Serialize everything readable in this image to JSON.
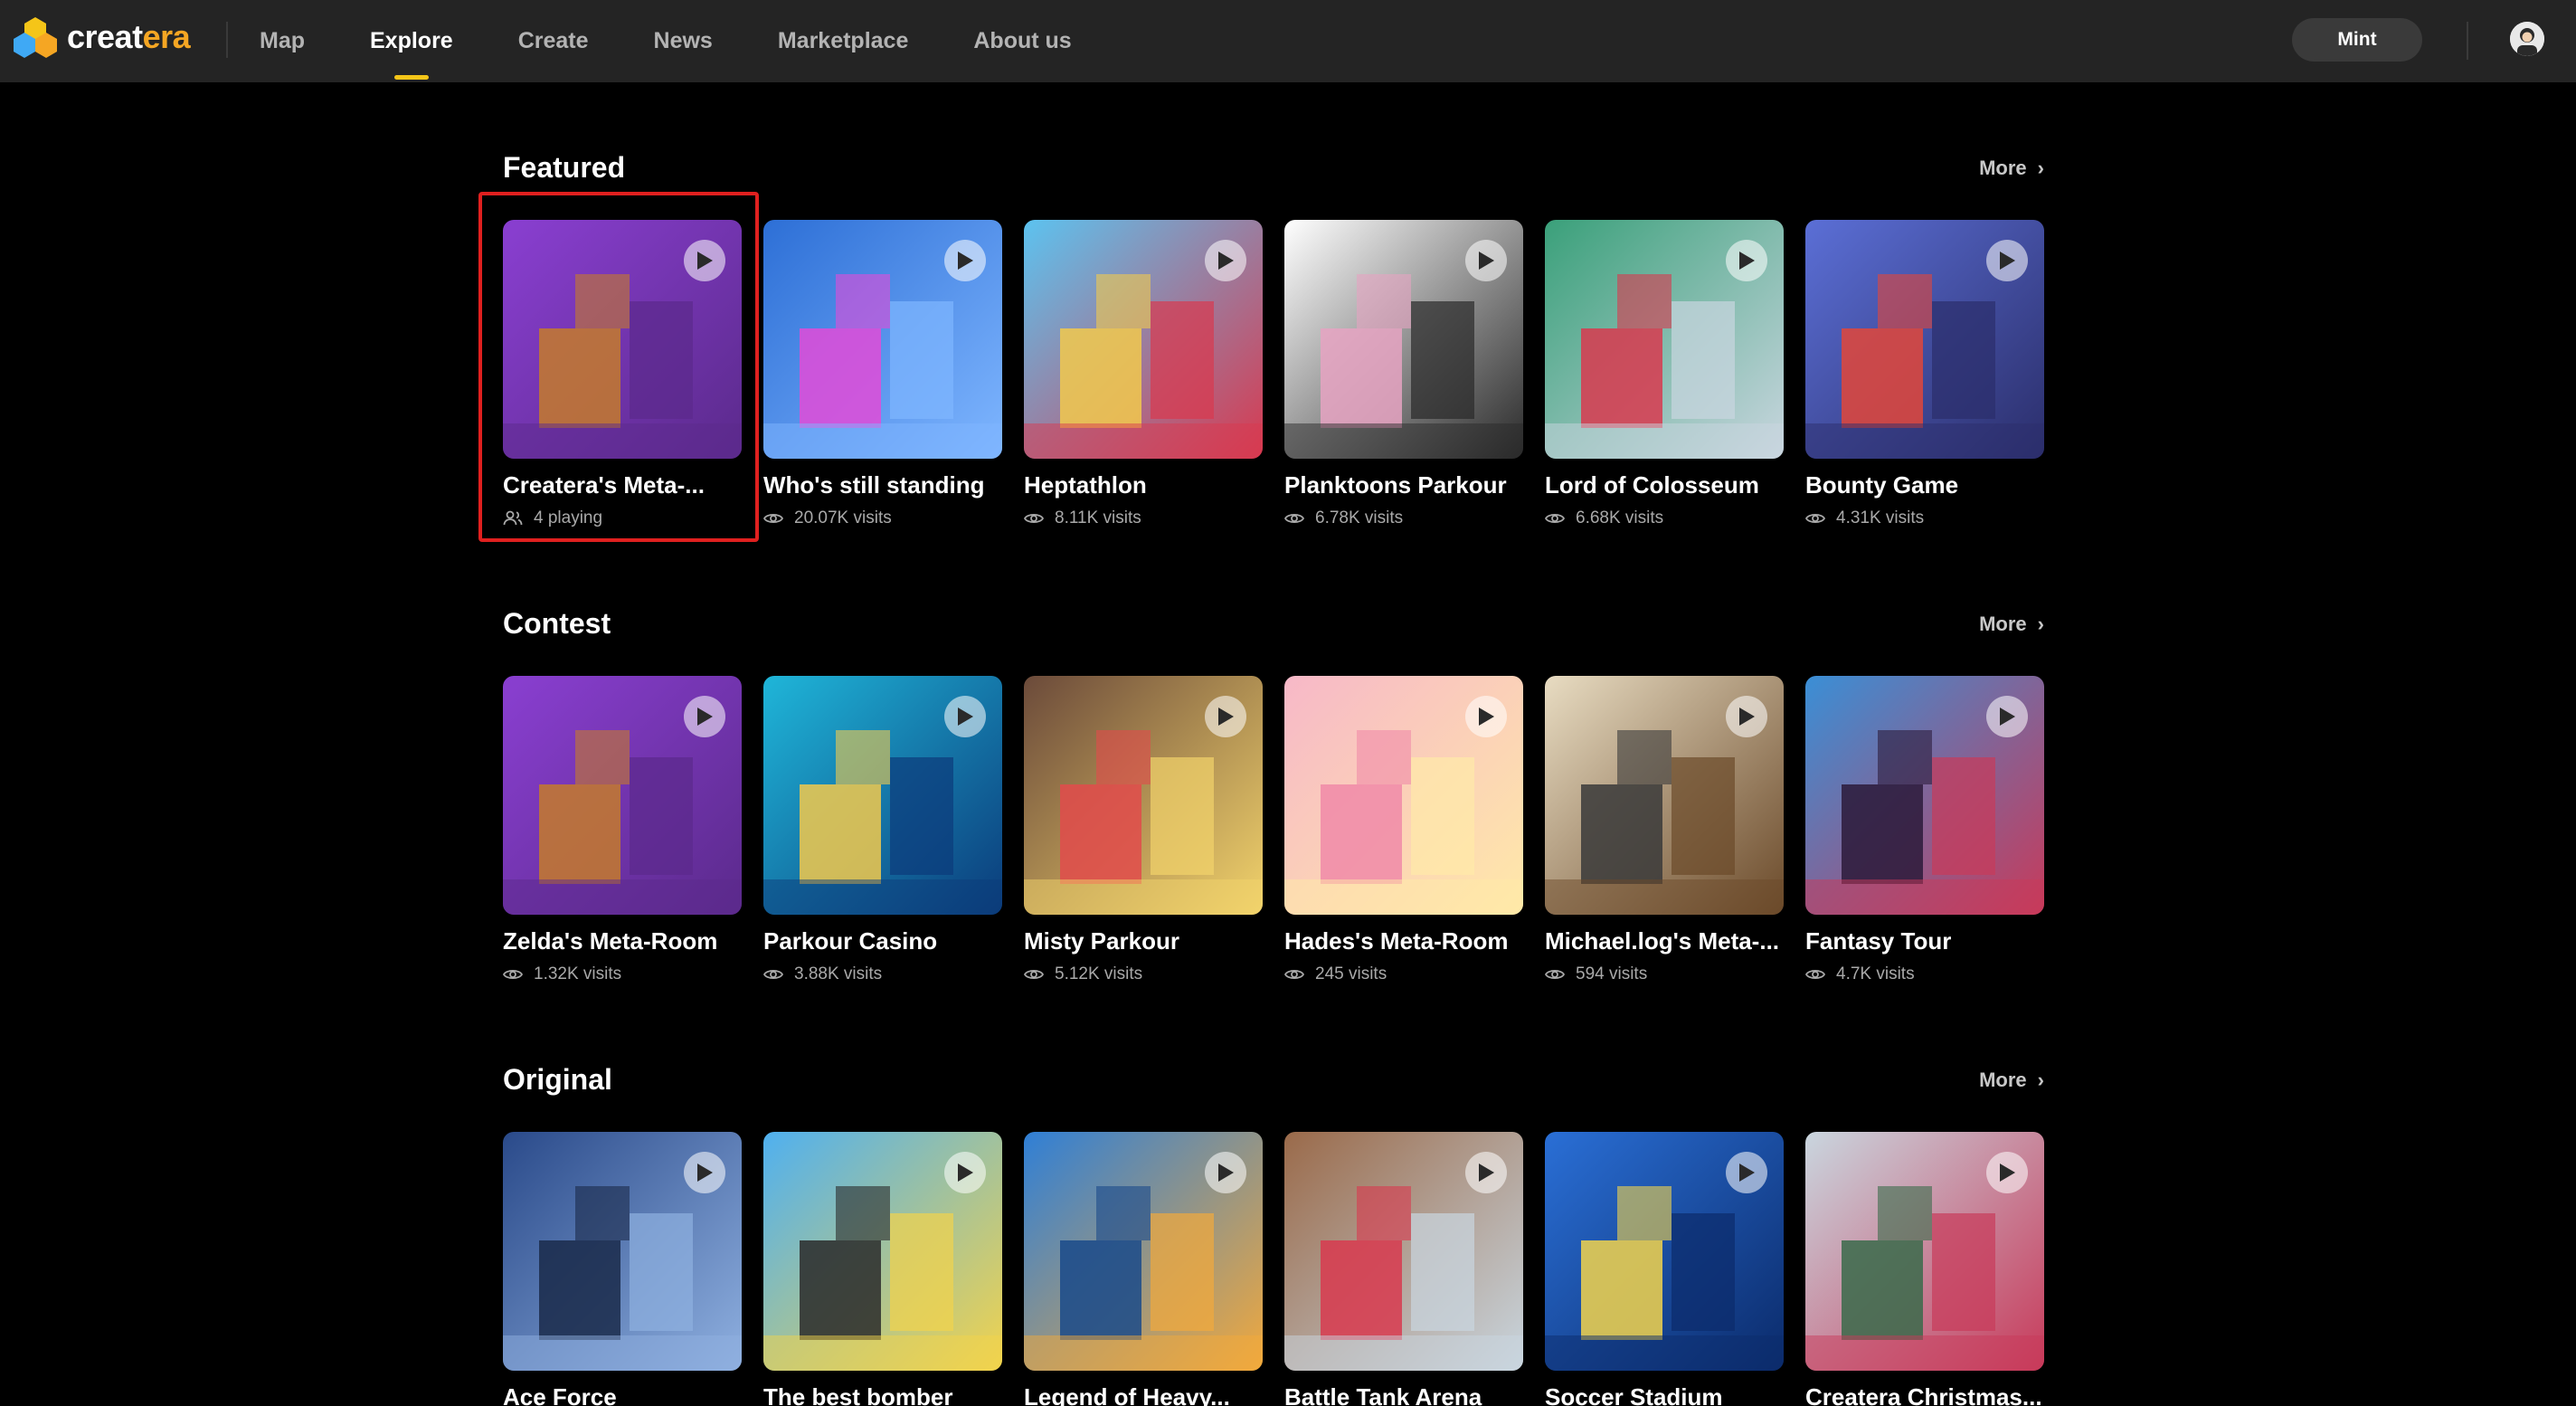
{
  "app": {
    "logo_text_white": "creat",
    "logo_text_yellow": "era"
  },
  "nav": {
    "items": [
      {
        "label": "Map",
        "active": false
      },
      {
        "label": "Explore",
        "active": true
      },
      {
        "label": "Create",
        "active": false
      },
      {
        "label": "News",
        "active": false
      },
      {
        "label": "Marketplace",
        "active": false
      },
      {
        "label": "About us",
        "active": false
      }
    ],
    "mint_label": "Mint"
  },
  "colors": {
    "accent": "#f5c518",
    "highlight": "#e0201f",
    "topbar": "#242424"
  },
  "sections": [
    {
      "title": "Featured",
      "more_label": "More",
      "cards": [
        {
          "title": "Createra's Meta-...",
          "meta": "4 playing",
          "meta_icon": "users-icon",
          "palette": [
            "#8a3fd1",
            "#5b2a8c",
            "#c47a2c"
          ]
        },
        {
          "title": "Who's still standing",
          "meta": "20.07K visits",
          "meta_icon": "eye-icon",
          "palette": [
            "#2d6fd6",
            "#7fb6ff",
            "#e24bd8"
          ]
        },
        {
          "title": "Heptathlon",
          "meta": "8.11K visits",
          "meta_icon": "eye-icon",
          "palette": [
            "#5cc3f0",
            "#d8394f",
            "#f2c94c"
          ]
        },
        {
          "title": "Planktoons Parkour",
          "meta": "6.78K visits",
          "meta_icon": "eye-icon",
          "palette": [
            "#ffffff",
            "#2a2a2a",
            "#e6a3c2"
          ]
        },
        {
          "title": "Lord of Colosseum",
          "meta": "6.68K visits",
          "meta_icon": "eye-icon",
          "palette": [
            "#3aa07a",
            "#c9d6df",
            "#d8394f"
          ]
        },
        {
          "title": "Bounty Game",
          "meta": "4.31K visits",
          "meta_icon": "eye-icon",
          "palette": [
            "#5b6fd6",
            "#2b2e6b",
            "#e2463a"
          ]
        }
      ]
    },
    {
      "title": "Contest",
      "more_label": "More",
      "cards": [
        {
          "title": "Zelda's Meta-Room",
          "meta": "1.32K visits",
          "meta_icon": "eye-icon",
          "palette": [
            "#8a3fd1",
            "#5b2a8c",
            "#c47a2c"
          ]
        },
        {
          "title": "Parkour Casino",
          "meta": "3.88K visits",
          "meta_icon": "eye-icon",
          "palette": [
            "#1fb6d9",
            "#0b3b7a",
            "#f2c94c"
          ]
        },
        {
          "title": "Misty Parkour",
          "meta": "5.12K visits",
          "meta_icon": "eye-icon",
          "palette": [
            "#6b4a3a",
            "#f2d36b",
            "#e24b4b"
          ]
        },
        {
          "title": "Hades's Meta-Room",
          "meta": "245 visits",
          "meta_icon": "eye-icon",
          "palette": [
            "#f7b8c8",
            "#ffe9a8",
            "#f08aa8"
          ]
        },
        {
          "title": "Michael.log's Meta-...",
          "meta": "594 visits",
          "meta_icon": "eye-icon",
          "palette": [
            "#e8dcc2",
            "#6b4a2a",
            "#3a3a3a"
          ]
        },
        {
          "title": "Fantasy Tour",
          "meta": "4.7K visits",
          "meta_icon": "eye-icon",
          "palette": [
            "#3a8fd6",
            "#c83a5a",
            "#2b1a3a"
          ]
        }
      ]
    },
    {
      "title": "Original",
      "more_label": "More",
      "cards": [
        {
          "title": "Ace Force",
          "meta": "",
          "meta_icon": "eye-icon",
          "palette": [
            "#2a4a8a",
            "#8fb0e0",
            "#1a2a4a"
          ]
        },
        {
          "title": "The best bomber",
          "meta": "",
          "meta_icon": "eye-icon",
          "palette": [
            "#4fb0f0",
            "#f2d34c",
            "#2a2a2a"
          ]
        },
        {
          "title": "Legend of Heavy...",
          "meta": "",
          "meta_icon": "eye-icon",
          "palette": [
            "#2f7fd6",
            "#f2a93c",
            "#1a4a8a"
          ]
        },
        {
          "title": "Battle Tank Arena",
          "meta": "",
          "meta_icon": "eye-icon",
          "palette": [
            "#9a6a4a",
            "#c9d6df",
            "#d8394f"
          ]
        },
        {
          "title": "Soccer Stadium",
          "meta": "",
          "meta_icon": "eye-icon",
          "palette": [
            "#2a6fd6",
            "#0b2b6b",
            "#f2d34c"
          ]
        },
        {
          "title": "Createra Christmas...",
          "meta": "",
          "meta_icon": "eye-icon",
          "palette": [
            "#c9d6df",
            "#c83a5a",
            "#3a6a4a"
          ]
        }
      ]
    }
  ]
}
